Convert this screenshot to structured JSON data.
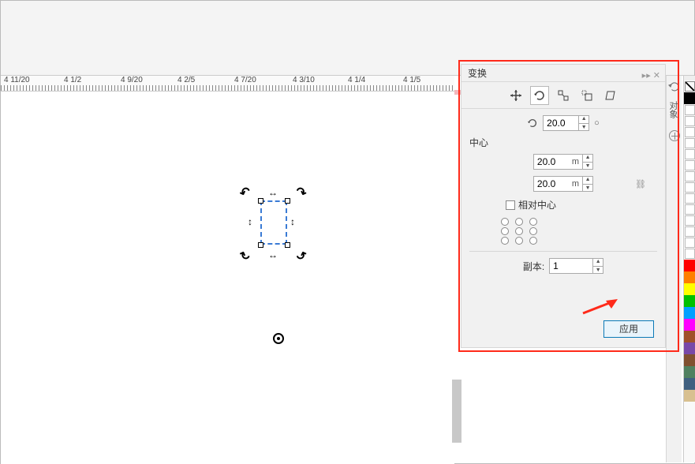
{
  "ruler": {
    "labels": [
      "4 11/20",
      "4 1/2",
      "4 9/20",
      "4 2/5",
      "4 7/20",
      "4 3/10",
      "4 1/4",
      "4 1/5"
    ]
  },
  "panel": {
    "title": "变换",
    "tabs": {
      "position": "position-icon",
      "rotate": "rotate-icon",
      "scale": "scale-icon",
      "size": "size-icon",
      "skew": "skew-icon"
    },
    "rotate": {
      "angle": "20.0"
    },
    "center_label": "中心",
    "center": {
      "x": "20.0",
      "y": "20.0",
      "unit_x": "m",
      "unit_y": "m",
      "relative_label": "相对中心"
    },
    "copies_label": "副本:",
    "copies_value": "1",
    "apply_label": "应用"
  },
  "dock": {
    "tab_label": "对象"
  },
  "colors": {
    "noclr": true,
    "swatches": [
      "#000000",
      "",
      "",
      "",
      "",
      "",
      "",
      "",
      "",
      "",
      "",
      "",
      "",
      "",
      "",
      "",
      "#ff0000",
      "#ff7f00",
      "#ffff00",
      "#00c000",
      "#00a0ff",
      "#ff00ff",
      "#a05028",
      "#7848a8",
      "#805030",
      "#508060",
      "#406080",
      "#d8c090"
    ]
  }
}
